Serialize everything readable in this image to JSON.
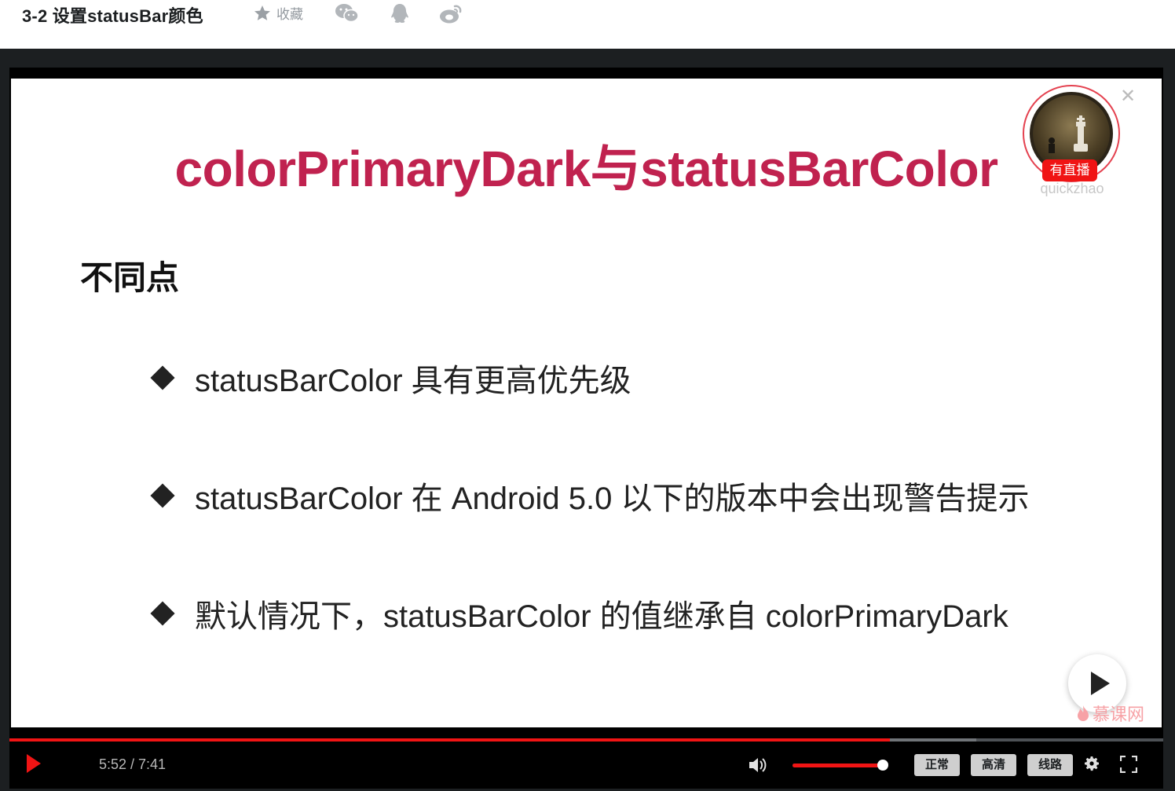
{
  "header": {
    "title": "3-2 设置statusBar颜色",
    "favorite_label": "收藏",
    "share_icons": [
      "wechat-icon",
      "qq-icon",
      "weibo-icon"
    ]
  },
  "slide": {
    "title": "colorPrimaryDark与statusBarColor",
    "heading": "不同点",
    "bullets": [
      "statusBarColor 具有更高优先级",
      "statusBarColor 在 Android 5.0 以下的版本中会出现警告提示",
      "默认情况下，statusBarColor 的值继承自 colorPrimaryDark"
    ]
  },
  "streamer": {
    "live_badge": "有直播",
    "name": "quickzhao"
  },
  "watermark": "慕课网",
  "player": {
    "time_current": "5:52",
    "time_total": "7:41",
    "time_display": "5:52 / 7:41",
    "progress": 0.763,
    "buffered": 0.838,
    "volume": 0.96,
    "speed_label": "正常",
    "quality_label": "高清",
    "line_label": "线路"
  },
  "colors": {
    "accent": "#f01414",
    "title": "#c0224f"
  }
}
